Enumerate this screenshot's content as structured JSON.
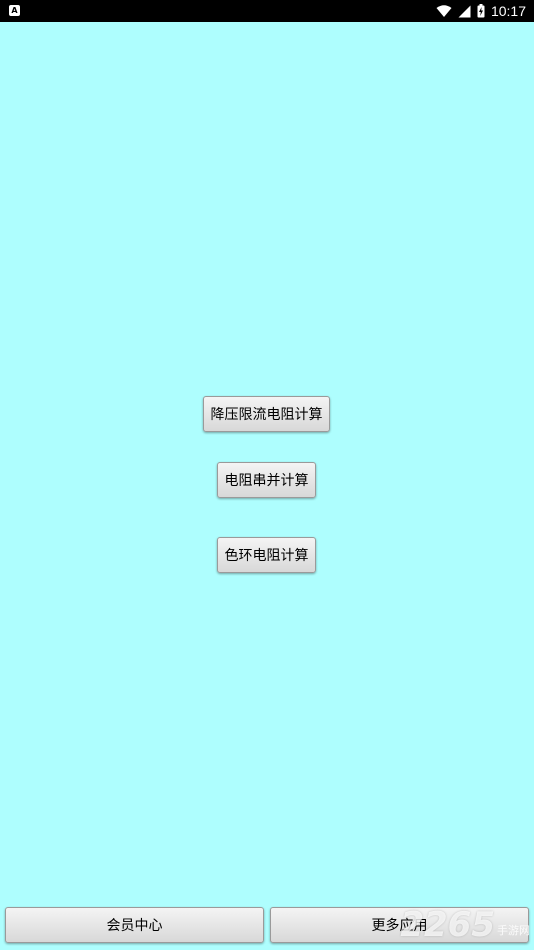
{
  "status_bar": {
    "left_icon": "A",
    "time": "10:17",
    "icons": [
      "wifi-icon",
      "signal-icon",
      "battery-icon"
    ]
  },
  "main": {
    "buttons": [
      {
        "label": "降压限流电阻计算"
      },
      {
        "label": "电阻串并计算"
      },
      {
        "label": "色环电阻计算"
      }
    ]
  },
  "bottom_bar": {
    "member_label": "会员中心",
    "more_label": "更多应用"
  },
  "watermark": {
    "number": "2265",
    "text": "手游网"
  },
  "colors": {
    "background": "#aefefe",
    "status_bar": "#000000"
  }
}
